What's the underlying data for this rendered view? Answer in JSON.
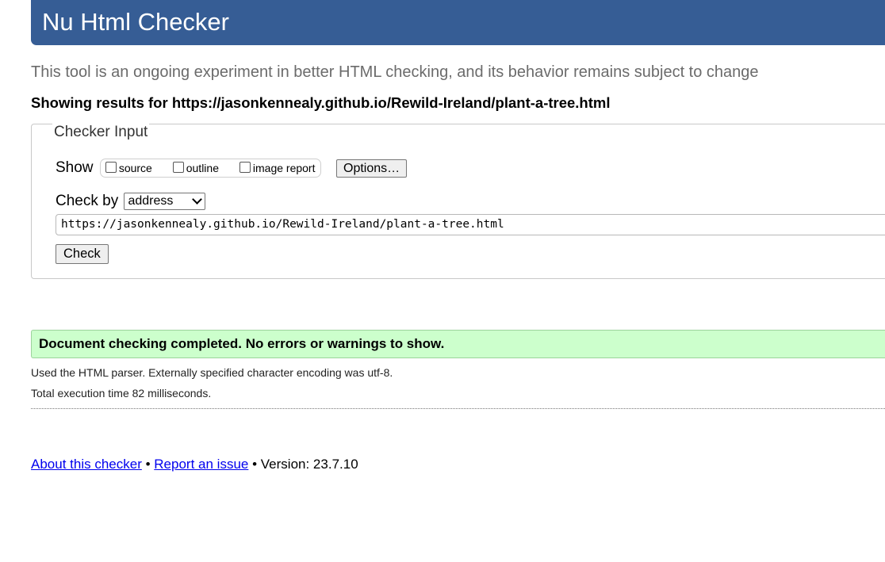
{
  "header": {
    "title": "Nu Html Checker",
    "brand_color": "#365d95"
  },
  "tagline": "This tool is an ongoing experiment in better HTML checking, and its behavior remains subject to change",
  "results": {
    "prefix": "Showing results for",
    "url": "https://jasonkennealy.github.io/Rewild-Ireland/plant-a-tree.html"
  },
  "checker_input": {
    "legend": "Checker Input",
    "show_label": "Show",
    "show_options": [
      {
        "label": "source",
        "checked": false
      },
      {
        "label": "outline",
        "checked": false
      },
      {
        "label": "image report",
        "checked": false
      }
    ],
    "options_button": "Options…",
    "check_by_label": "Check by",
    "check_by_selected": "address",
    "address_value": "https://jasonkennealy.github.io/Rewild-Ireland/plant-a-tree.html",
    "check_button": "Check"
  },
  "status": {
    "message": "Document checking completed. No errors or warnings to show.",
    "color": "#ccffcc",
    "parser_note": "Used the HTML parser. Externally specified character encoding was utf-8.",
    "execution_time": "Total execution time 82 milliseconds."
  },
  "footer": {
    "about_link": "About this checker",
    "separator": "•",
    "report_link": "Report an issue",
    "version": "Version: 23.7.10"
  }
}
